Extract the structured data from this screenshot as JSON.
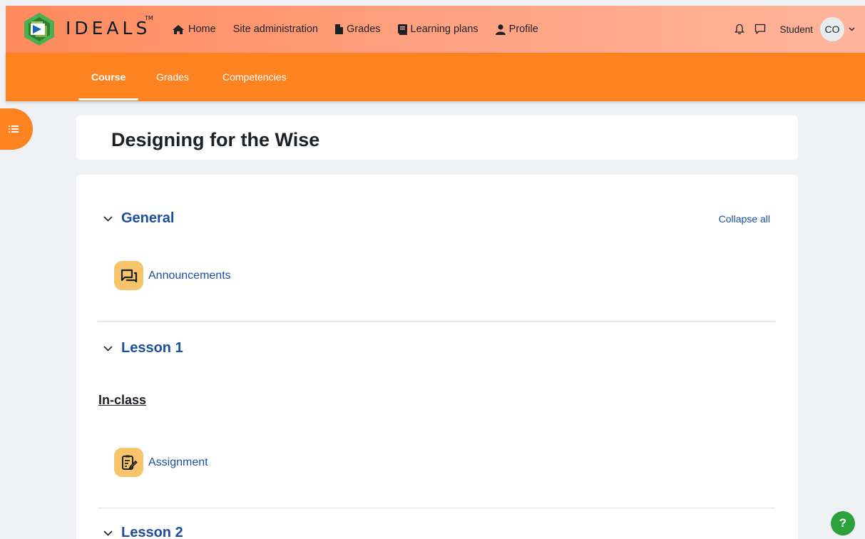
{
  "brand": {
    "name": "IDEALS",
    "tm": "TM"
  },
  "topnav": {
    "items": [
      {
        "label": "Home",
        "icon": "home-icon"
      },
      {
        "label": "Site administration",
        "icon": ""
      },
      {
        "label": "Grades",
        "icon": "file-icon"
      },
      {
        "label": "Learning plans",
        "icon": "book-icon"
      },
      {
        "label": "Profile",
        "icon": "user-icon"
      }
    ],
    "role": "Student",
    "avatar_initials": "CO"
  },
  "secondary_nav": {
    "tabs": [
      {
        "label": "Course",
        "active": true
      },
      {
        "label": "Grades",
        "active": false
      },
      {
        "label": "Competencies",
        "active": false
      }
    ]
  },
  "page": {
    "title": "Designing for the Wise"
  },
  "course": {
    "collapse_all": "Collapse all",
    "sections": [
      {
        "title": "General",
        "activities": [
          {
            "label": "Announcements",
            "icon": "forum-icon"
          }
        ]
      },
      {
        "title": "Lesson 1",
        "subheading": "In-class",
        "activities": [
          {
            "label": "Assignment",
            "icon": "assignment-icon"
          }
        ]
      },
      {
        "title": "Lesson 2"
      }
    ]
  },
  "help": {
    "label": "?"
  },
  "colors": {
    "primary_orange": "#ff8220",
    "link_blue": "#1c4fa0",
    "activity_icon_bg": "#f7c46c",
    "help_green": "#2aa23c"
  }
}
